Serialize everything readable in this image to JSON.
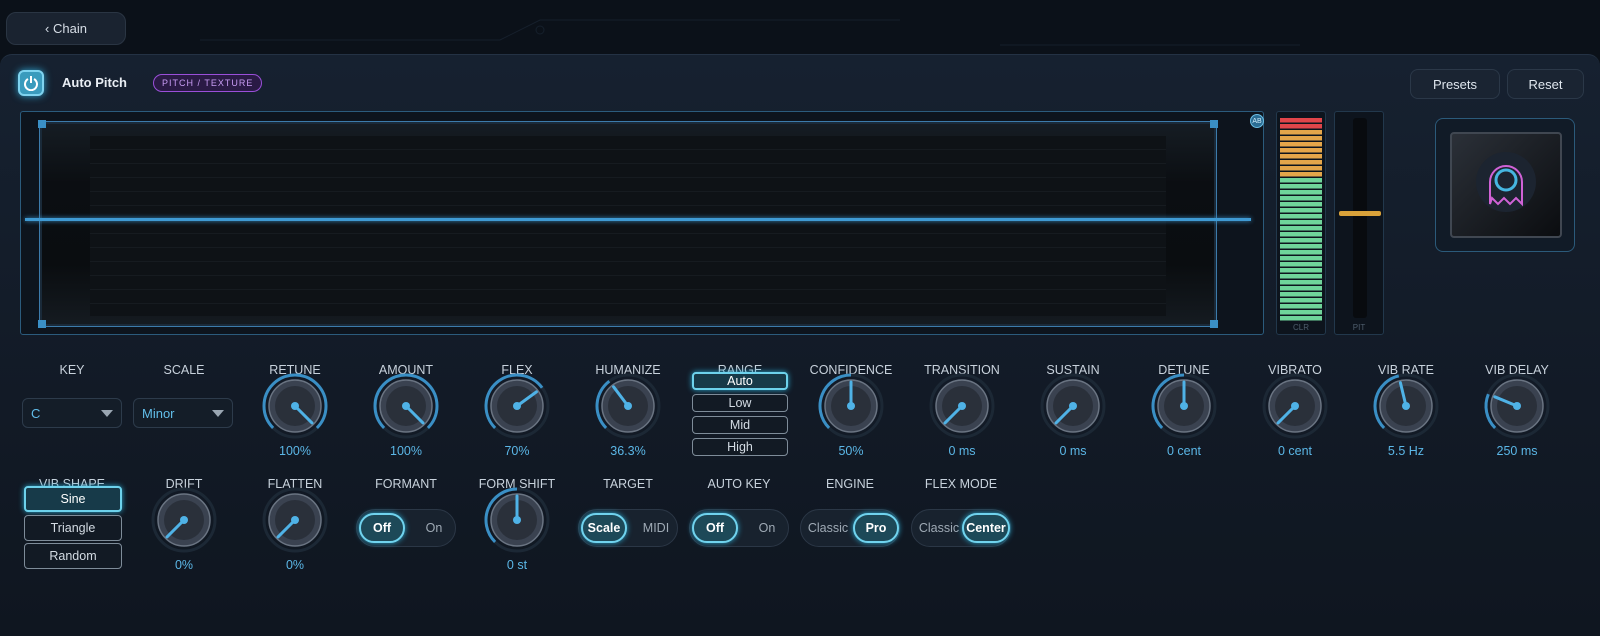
{
  "nav": {
    "back_label": "‹ Chain"
  },
  "header": {
    "title": "Auto Pitch",
    "badge": "PITCH / TEXTURE",
    "presets_label": "Presets",
    "reset_label": "Reset"
  },
  "display": {
    "ab_label": "AB"
  },
  "meters": {
    "level_label": "CLR",
    "pitch_label": "PIT"
  },
  "key": {
    "label": "KEY",
    "value": "C"
  },
  "scale": {
    "label": "SCALE",
    "value": "Minor"
  },
  "knobs_row1": [
    {
      "label": "RETUNE",
      "value": "100%",
      "level": 1.0
    },
    {
      "label": "AMOUNT",
      "value": "100%",
      "level": 1.0
    },
    {
      "label": "FLEX",
      "value": "70%",
      "level": 0.7
    },
    {
      "label": "HUMANIZE",
      "value": "36.3%",
      "level": 0.363
    },
    {
      "label": "CONFIDENCE",
      "value": "50%",
      "level": 0.5
    },
    {
      "label": "TRANSITION",
      "value": "0 ms",
      "level": 0.0
    },
    {
      "label": "SUSTAIN",
      "value": "0 ms",
      "level": 0.0
    },
    {
      "label": "DETUNE",
      "value": "0 cent",
      "level": 0.5
    },
    {
      "label": "VIBRATO",
      "value": "0 cent",
      "level": 0.0
    },
    {
      "label": "VIB RATE",
      "value": "5.5 Hz",
      "level": 0.45
    },
    {
      "label": "VIB DELAY",
      "value": "250 ms",
      "level": 0.25
    }
  ],
  "range": {
    "label": "RANGE",
    "options": [
      "Auto",
      "Low",
      "Mid",
      "High"
    ],
    "selected": "Auto"
  },
  "vib_shape": {
    "label": "VIB SHAPE",
    "options": [
      "Sine",
      "Triangle",
      "Random"
    ],
    "selected": "Sine"
  },
  "knobs_row2": [
    {
      "label": "DRIFT",
      "value": "0%",
      "level": 0.0
    },
    {
      "label": "FLATTEN",
      "value": "0%",
      "level": 0.0
    },
    {
      "label": "FORM SHIFT",
      "value": "0 st",
      "level": 0.5
    }
  ],
  "toggles": [
    {
      "label": "FORMANT",
      "options": [
        "Off",
        "On"
      ],
      "selected": "Off"
    },
    {
      "label": "TARGET",
      "options": [
        "Scale",
        "MIDI"
      ],
      "selected": "Scale"
    },
    {
      "label": "AUTO KEY",
      "options": [
        "Off",
        "On"
      ],
      "selected": "Off"
    },
    {
      "label": "ENGINE",
      "options": [
        "Classic",
        "Pro"
      ],
      "selected": "Pro"
    },
    {
      "label": "FLEX MODE",
      "options": [
        "Classic",
        "Center"
      ],
      "selected": "Center"
    }
  ],
  "colors": {
    "accent": "#5bb6e6",
    "badge": "#9a4fd9",
    "meter_green": "#6fd49a",
    "meter_orange": "#e4a64a",
    "meter_red": "#e0454a"
  }
}
